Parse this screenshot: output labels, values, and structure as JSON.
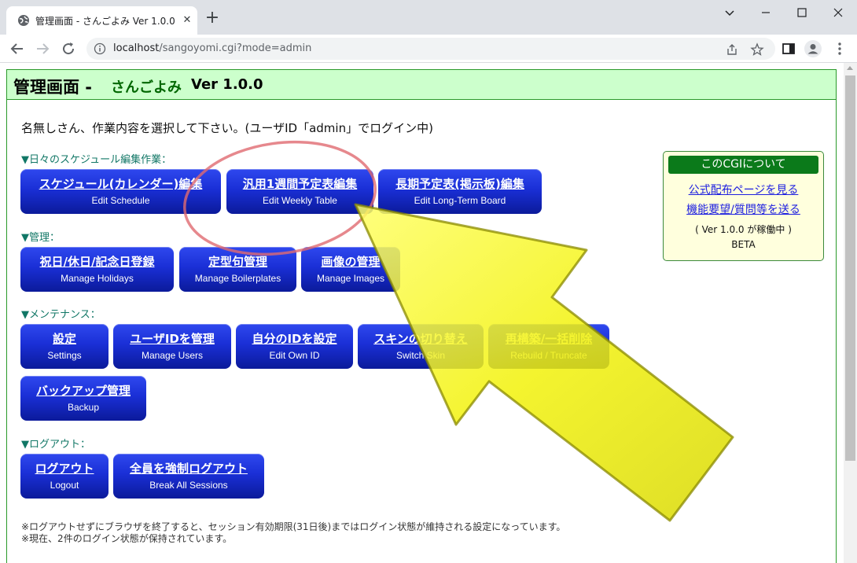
{
  "browser": {
    "tab_title": "管理画面 - さんごよみ Ver 1.0.0",
    "url_host": "localhost",
    "url_path": "/sangoyomi.cgi?mode=admin"
  },
  "header": {
    "title": "管理画面 -",
    "app_name": "さんごよみ",
    "version": "Ver 1.0.0"
  },
  "welcome": "名無しさん、作業内容を選択して下さい。(ユーザID「admin」でログイン中)",
  "sections": {
    "schedule": {
      "label": "▼日々のスケジュール編集作業：",
      "buttons": [
        {
          "ja": "スケジュール(カレンダー)編集",
          "en": "Edit Schedule"
        },
        {
          "ja": "汎用1週間予定表編集",
          "en": "Edit Weekly Table"
        },
        {
          "ja": "長期予定表(掲示板)編集",
          "en": "Edit Long-Term Board"
        }
      ]
    },
    "admin": {
      "label": "▼管理：",
      "buttons": [
        {
          "ja": "祝日/休日/記念日登録",
          "en": "Manage Holidays"
        },
        {
          "ja": "定型句管理",
          "en": "Manage Boilerplates"
        },
        {
          "ja": "画像の管理",
          "en": "Manage Images"
        }
      ]
    },
    "maintenance": {
      "label": "▼メンテナンス：",
      "buttons": [
        {
          "ja": "設定",
          "en": "Settings"
        },
        {
          "ja": "ユーザIDを管理",
          "en": "Manage Users"
        },
        {
          "ja": "自分のIDを設定",
          "en": "Edit Own ID"
        },
        {
          "ja": "スキンの切り替え",
          "en": "Switch Skin"
        },
        {
          "ja": "再構築/一括削除",
          "en": "Rebuild / Truncate"
        },
        {
          "ja": "バックアップ管理",
          "en": "Backup"
        }
      ]
    },
    "logout": {
      "label": "▼ログアウト：",
      "buttons": [
        {
          "ja": "ログアウト",
          "en": "Logout"
        },
        {
          "ja": "全員を強制ログアウト",
          "en": "Break All Sessions"
        }
      ]
    }
  },
  "about": {
    "title": "このCGIについて",
    "link1": "公式配布ページを見る",
    "link2": "機能要望/質問等を送る",
    "running": "( Ver 1.0.0 が稼働中 )",
    "beta": "BETA"
  },
  "footnotes": [
    "※ログアウトせずにブラウザを終了すると、セッション有効期限(31日後)まではログイン状態が維持される設定になっています。",
    "※現在、2件のログイン状態が保持されています。"
  ],
  "colors": {
    "button_blue": "#1a2fd6",
    "header_green_bg": "#ccffcc",
    "section_teal": "#117766",
    "arrow_yellow": "#f2f20a",
    "circle_red": "#e06a70"
  }
}
